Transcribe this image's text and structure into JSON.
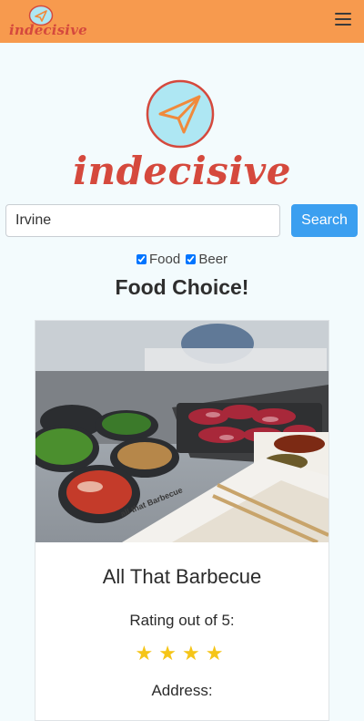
{
  "navbar": {
    "brand": "indecisive",
    "menu_icon": "hamburger-icon",
    "background": "#f79a4e"
  },
  "hero": {
    "brand": "indecisive",
    "logo_icon": "paper-plane-icon",
    "brand_color": "#d5493d"
  },
  "search": {
    "value": "Irvine",
    "button_label": "Search",
    "button_color": "#3b9ff0"
  },
  "filters": [
    {
      "label": "Food",
      "checked": true
    },
    {
      "label": "Beer",
      "checked": true
    }
  ],
  "section_title": "Food Choice!",
  "result": {
    "name": "All That Barbecue",
    "rating_label": "Rating out of 5:",
    "rating": 4,
    "stars": "★★★★",
    "address_label": "Address:",
    "photo_sign_text": "all that Barbecue"
  }
}
